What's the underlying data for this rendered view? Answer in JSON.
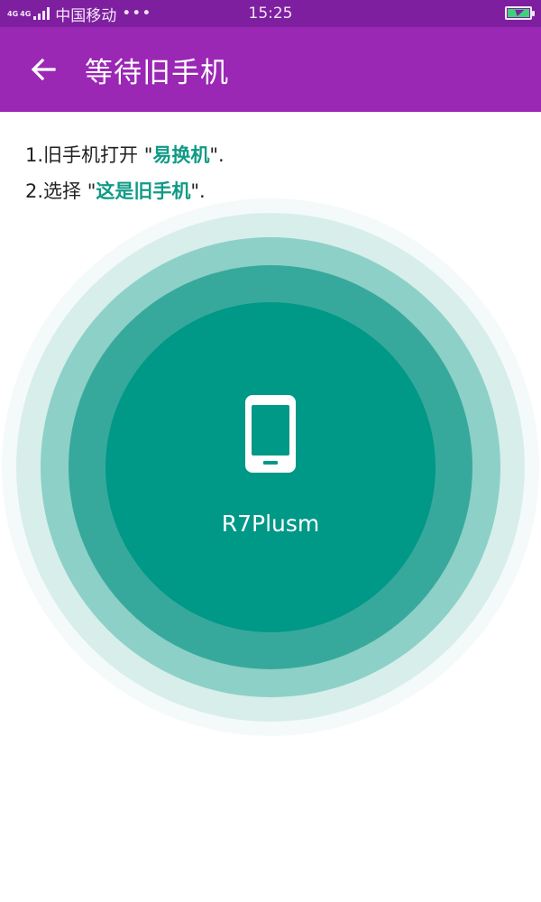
{
  "status_bar": {
    "net_type_1": "4G",
    "net_type_2": "4G",
    "carrier": "中国移动",
    "more": "•••",
    "time": "15:25",
    "battery_icon": "battery-charging-icon"
  },
  "header": {
    "back_icon": "arrow-left-icon",
    "title": "等待旧手机"
  },
  "instructions": {
    "step1_prefix": "1.旧手机打开 \"",
    "step1_app": "易换机",
    "step1_suffix": "\".",
    "step2_prefix": "2.选择 \"",
    "step2_option": "这是旧手机",
    "step2_suffix": "\"."
  },
  "device": {
    "icon": "smartphone-icon",
    "name": "R7Plusm"
  },
  "colors": {
    "status_bar": "#7e1fa0",
    "app_bar": "#9b27b5",
    "accent_text": "#109a86",
    "core": "#009887",
    "ring_inner": "#37a99c",
    "ring_mid": "#8dd0c7",
    "ring_outer": "#d8eeeb",
    "ring_halo": "#f4faf9"
  }
}
